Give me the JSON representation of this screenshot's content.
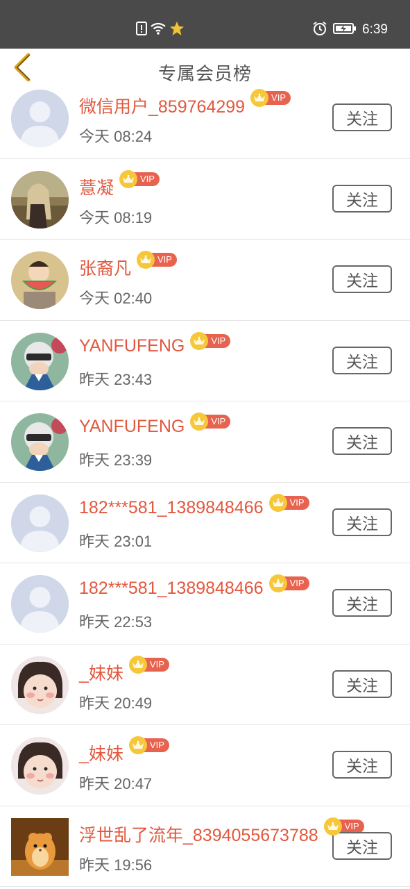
{
  "status_bar": {
    "time": "6:39",
    "icons_center": [
      "alert-icon",
      "wifi-icon",
      "star-icon"
    ],
    "icons_right": [
      "alarm-icon",
      "battery-icon"
    ]
  },
  "header": {
    "title": "专属会员榜",
    "back_icon": "chevron-left-icon"
  },
  "vip_label": "VIP",
  "follow_label": "关注",
  "members": [
    {
      "name": "微信用户_859764299",
      "time": "今天 08:24",
      "avatar": "default"
    },
    {
      "name": "薏凝",
      "time": "今天 08:19",
      "avatar": "photo-girl"
    },
    {
      "name": "张裔凡",
      "time": "今天 02:40",
      "avatar": "photo-baby-watermelon"
    },
    {
      "name": "YANFUFENG",
      "time": "昨天 23:43",
      "avatar": "photo-helmet-boy"
    },
    {
      "name": "YANFUFENG",
      "time": "昨天 23:39",
      "avatar": "photo-helmet-boy"
    },
    {
      "name": "182***581_1389848466",
      "time": "昨天 23:01",
      "avatar": "default"
    },
    {
      "name": "182***581_1389848466",
      "time": "昨天 22:53",
      "avatar": "default"
    },
    {
      "name": "_妹妹",
      "time": "昨天 20:49",
      "avatar": "photo-baby-girl"
    },
    {
      "name": "_妹妹",
      "time": "昨天 20:47",
      "avatar": "photo-baby-girl"
    },
    {
      "name": "浮世乱了流年_8394055673788",
      "time": "昨天 19:56",
      "avatar": "photo-hamster"
    }
  ],
  "colors": {
    "status_bar": "#4a4a4a",
    "name": "#e2583e",
    "vip_tag": "#e8634f",
    "crown": "#f7c73a",
    "time": "#666666",
    "back_icon": "#d9a017"
  }
}
